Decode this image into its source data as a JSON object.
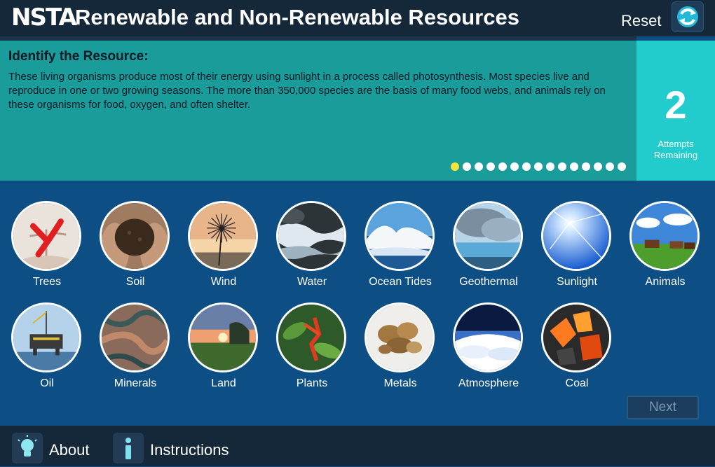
{
  "header": {
    "logo": "NSTA",
    "title": "Renewable and Non-Renewable Resources",
    "reset_label": "Reset"
  },
  "question": {
    "heading": "Identify the Resource:",
    "text": "These living organisms produce most of their energy using sunlight in a process called photosynthesis. Most species live and reproduce in one or two growing seasons. The more than 350,000 species are the basis of many food webs, and animals rely on these organisms for food, oxygen, and often shelter.",
    "progress_total": 15,
    "progress_current": 1
  },
  "attempts": {
    "count": "2",
    "label": "Attempts Remaining"
  },
  "resources": [
    {
      "label": "Trees",
      "icon": "trees-icon",
      "marked_wrong": true
    },
    {
      "label": "Soil",
      "icon": "soil-icon"
    },
    {
      "label": "Wind",
      "icon": "dandelion-icon"
    },
    {
      "label": "Water",
      "icon": "water-icon"
    },
    {
      "label": "Ocean Tides",
      "icon": "wave-icon"
    },
    {
      "label": "Geothermal",
      "icon": "geothermal-icon"
    },
    {
      "label": "Sunlight",
      "icon": "sun-icon"
    },
    {
      "label": "Animals",
      "icon": "cattle-icon"
    },
    {
      "label": "Oil",
      "icon": "oil-rig-icon"
    },
    {
      "label": "Minerals",
      "icon": "minerals-icon"
    },
    {
      "label": "Land",
      "icon": "land-icon"
    },
    {
      "label": "Plants",
      "icon": "plant-icon"
    },
    {
      "label": "Metals",
      "icon": "metals-icon"
    },
    {
      "label": "Atmosphere",
      "icon": "atmosphere-icon"
    },
    {
      "label": "Coal",
      "icon": "coal-icon"
    }
  ],
  "next_label": "Next",
  "footer": {
    "about_label": "About",
    "instructions_label": "Instructions"
  },
  "colors": {
    "header_bg": "#14283a",
    "question_bg": "#1a9c9a",
    "attempts_bg": "#23cccc",
    "main_bg": "#0d4e84",
    "active_dot": "#f3e33b",
    "wrong_mark": "#e02020"
  }
}
